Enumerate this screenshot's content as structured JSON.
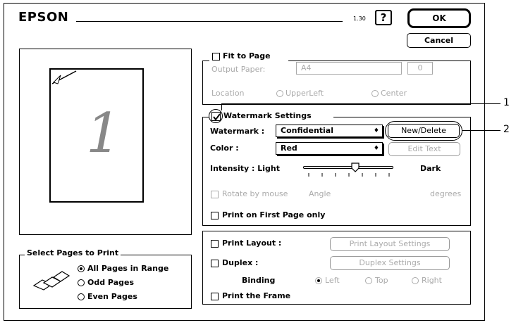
{
  "app": {
    "brand": "EPSON",
    "version": "1.30"
  },
  "buttons": {
    "help": "?",
    "ok": "OK",
    "cancel": "Cancel"
  },
  "preview": {
    "page_number": "1"
  },
  "fit_to_page": {
    "label": "Fit to Page",
    "output_paper_label": "Output Paper:",
    "output_paper_value": "A4",
    "output_paper_count": "0",
    "location_label": "Location",
    "location_options": [
      "UpperLeft",
      "Center"
    ]
  },
  "watermark": {
    "settings_label": "Watermark Settings",
    "watermark_label": "Watermark :",
    "watermark_value": "Confidential",
    "new_delete": "New/Delete",
    "color_label": "Color :",
    "color_value": "Red",
    "edit_text": "Edit Text",
    "intensity_label": "Intensity : Light",
    "intensity_dark": "Dark",
    "rotate_label": "Rotate by mouse",
    "angle_label": "Angle",
    "degrees_label": "degrees",
    "first_page_label": "Print on First Page only"
  },
  "layout": {
    "print_layout_label": "Print Layout :",
    "print_layout_settings": "Print Layout Settings",
    "duplex_label": "Duplex :",
    "duplex_settings": "Duplex Settings",
    "binding_label": "Binding",
    "binding_options": [
      "Left",
      "Top",
      "Right"
    ],
    "print_frame_label": "Print the Frame"
  },
  "select_pages": {
    "title": "Select Pages to Print",
    "options": [
      "All Pages in Range",
      "Odd Pages",
      "Even Pages"
    ]
  },
  "callouts": [
    "1",
    "2"
  ]
}
